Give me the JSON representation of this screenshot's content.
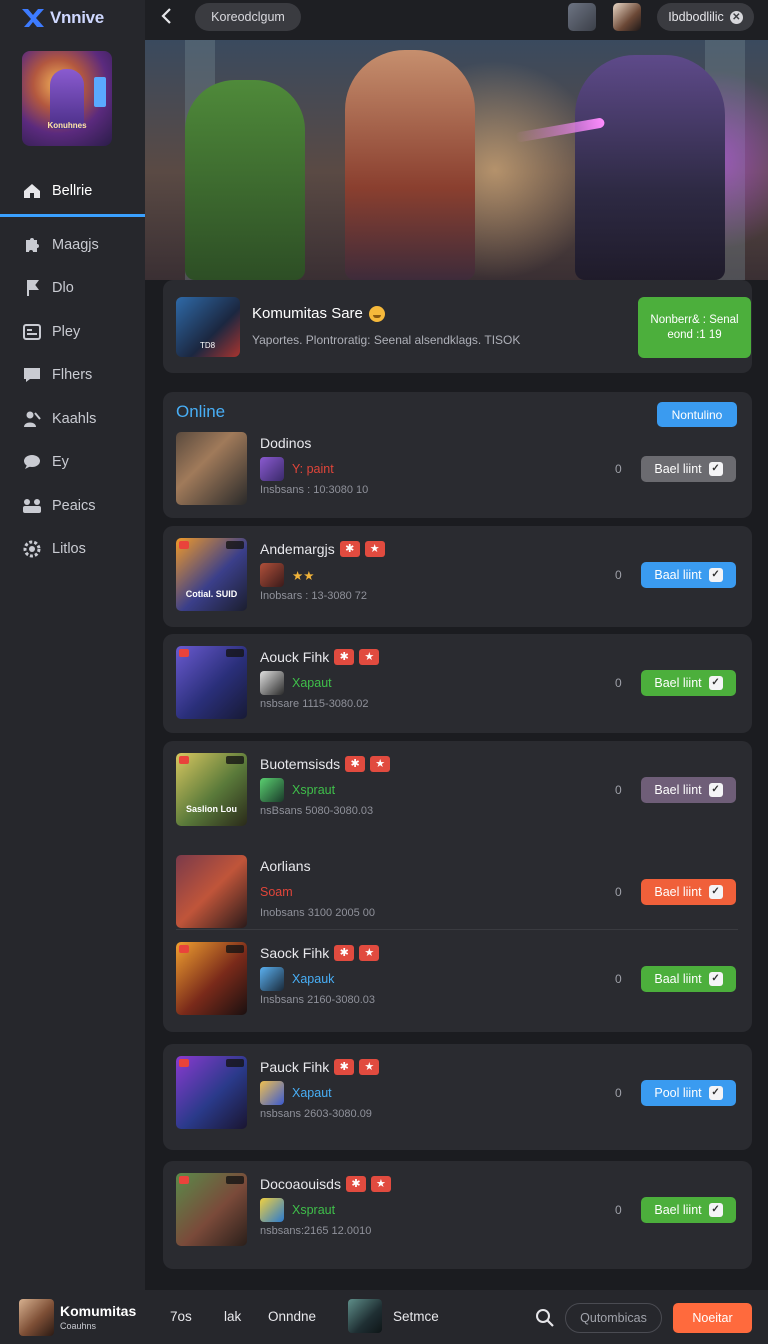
{
  "app": {
    "name": "Vnnive"
  },
  "sidebar": {
    "art_caption": "Konuhnes",
    "items": [
      {
        "label": "Bellrie",
        "icon": "home-icon",
        "active": true
      },
      {
        "label": "Maagjs",
        "icon": "puzzle-icon"
      },
      {
        "label": "Dlo",
        "icon": "flag-icon"
      },
      {
        "label": "Pley",
        "icon": "card-icon"
      },
      {
        "label": "Flhers",
        "icon": "message-icon"
      },
      {
        "label": "Kaahls",
        "icon": "people-icon"
      },
      {
        "label": "Ey",
        "icon": "chat-icon"
      },
      {
        "label": "Peaics",
        "icon": "group-icon"
      },
      {
        "label": "Litlos",
        "icon": "gear-icon"
      }
    ]
  },
  "topbar": {
    "search_pill": "Koreodclgum",
    "right_button": "Ibdbodlilic"
  },
  "community": {
    "title": "Komumitas Sare",
    "description": "Yaportes. Plontroratig: Seenal alsendklags. TISOK",
    "thumb_label": "TD8",
    "cta_line1": "Nonberr& : Senal",
    "cta_line2": "eond :1 19"
  },
  "online": {
    "heading": "Online",
    "button": "Nontulino",
    "rows": [
      {
        "name": "Dodinos",
        "status": "Y: paint",
        "status_color": "#e0453a",
        "meta": "Insbsans : 10:3080 10",
        "count": "0",
        "action": "Bael liint",
        "action_color": "#6b6b70",
        "tags": false,
        "caption": ""
      },
      {
        "name": "Andemargjs",
        "status": "★★",
        "status_color": "#f0b33a",
        "meta": "Inobsars : 13-3080 72",
        "count": "0",
        "action": "Baal liint",
        "action_color": "#3a9bf0",
        "tags": true,
        "caption": "Cotial. SUID"
      },
      {
        "name": "Aouck Fihk",
        "status": "Xapaut",
        "status_color": "#3fbf4a",
        "meta": "nsbsare 1115-3080.02",
        "count": "0",
        "action": "Bael liint",
        "action_color": "#4caf3c",
        "tags": true,
        "caption": ""
      },
      {
        "name": "Buotemsisds",
        "status": "Xspraut",
        "status_color": "#3fbf4a",
        "meta": "nsBsans 5080-3080.03",
        "count": "0",
        "action": "Bael liint",
        "action_color": "#6f5e78",
        "tags": true,
        "caption": "Saslion Lou"
      },
      {
        "name": "Aorlians",
        "status": "Soam",
        "status_color": "#e0453a",
        "meta": "Inobsans 3100 2005 00",
        "count": "0",
        "action": "Bael liint",
        "action_color": "#f0603a",
        "tags": false,
        "caption": ""
      },
      {
        "name": "Saock Fihk",
        "status": "Xapauk",
        "status_color": "#48aef5",
        "meta": "Insbsans 2160-3080.03",
        "count": "0",
        "action": "Baal liint",
        "action_color": "#4caf3c",
        "tags": true,
        "caption": ""
      },
      {
        "name": "Pauck Fihk",
        "status": "Xapaut",
        "status_color": "#48aef5",
        "meta": "nsbsans 2603-3080.09",
        "count": "0",
        "action": "Pool liint",
        "action_color": "#3a9bf0",
        "tags": true,
        "caption": ""
      },
      {
        "name": "Docoaouisds",
        "status": "Xspraut",
        "status_color": "#3fbf4a",
        "meta": "nsbsans:2165 12.0010",
        "count": "0",
        "action": "Bael liint",
        "action_color": "#4caf3c",
        "tags": true,
        "caption": ""
      }
    ]
  },
  "bottombar": {
    "title": "Komumitas",
    "subtitle": "Coauhns",
    "link1": "7os",
    "link2": "lak",
    "link3": "Onndne",
    "link4": "Setmce",
    "pill": "Qutombicas",
    "cta": "Noeitar"
  }
}
